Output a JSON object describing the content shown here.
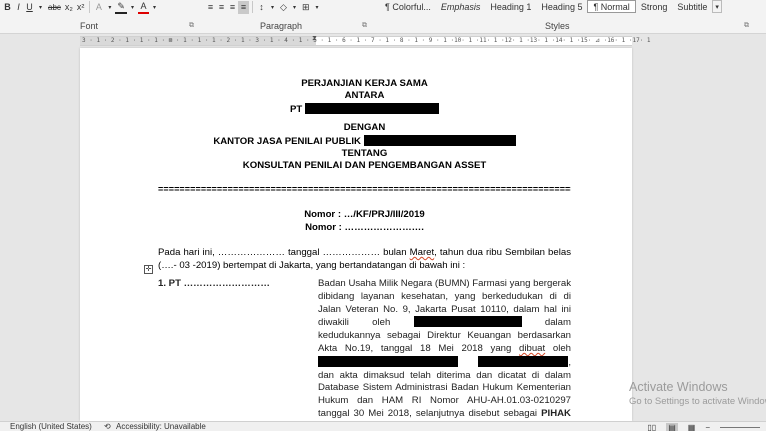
{
  "ribbon": {
    "font_buttons": [
      "B",
      "I",
      "U",
      "abc",
      "x₂",
      "x²"
    ],
    "paragraph_buttons": [
      "≡",
      "≡",
      "≡",
      "≡",
      "↕",
      "◇",
      "⊞"
    ],
    "styles": [
      "¶ Colorful...",
      "Emphasis",
      "Heading 1",
      "Heading 5",
      "¶ Normal",
      "Strong",
      "Subtitle"
    ],
    "selected_style": "¶ Normal",
    "groups": {
      "font": "Font",
      "paragraph": "Paragraph",
      "styles": "Styles"
    }
  },
  "ruler": {
    "ticks": "3 · 1 · 2 · 1 · 1 · 1 · ⊠ · 1 · 1 · 1 · 2 · 1 · 3 · 1 · 4 · 1 · 5 · 1 · 6 · 1 · 7 · 1 · 8 · 1 · 9 · 1 ·10· 1 ·11· 1 ·12· 1 ·13· 1 ·14· 1 ·15· ⊿ ·16· 1 ·17· 1"
  },
  "doc": {
    "title1": "PERJANJIAN KERJA SAMA",
    "title2": "ANTARA",
    "pt_prefix": "PT",
    "dengan": "DENGAN",
    "kantor_prefix": "KANTOR JASA PENILAI PUBLIK",
    "tentang": "TENTANG",
    "subject": "KONSULTAN PENILAI DAN PENGEMBANGAN ASSET",
    "separator": "==========================================================================================",
    "nomor1": "Nomor : …/KF/PRJ/III/2019",
    "nomor2": "Nomor : …………………….",
    "intro_a": "Pada hari ini, ………………… tanggal ……………… bulan ",
    "intro_maret": "Maret",
    "intro_b": ", tahun dua ribu Sembilan belas (….- 03 -2019) bertempat di Jakarta, yang bertandatangan di bawah ini :",
    "party_label": "1.  PT ………………………",
    "party_text_1": "Badan Usaha Milik Negara (BUMN) Farmasi yang bergerak dibidang layanan kesehatan, yang berkedudukan di di Jalan Veteran No. 9, Jakarta Pusat 10110, dalam hal ini diwakili oleh",
    "party_text_2": "dalam kedudukannya sebagai Direktur Keuangan berdasarkan Akta No.19, tanggal 18 Mei 2018 yang ",
    "party_dibuat": "dibuat",
    "party_text_3": " oleh",
    "party_text_4": ", dan akta dimaksud telah diterima dan dicatat di dalam Database Sistem Administrasi Badan Hukum Kementerian Hukum dan HAM RI Nomor AHU-AH.01.03-0210297 tanggal 30 Mei 2018, selanjutnya disebut sebagai ",
    "pihak": "PIHAK PERTAMA."
  },
  "status": {
    "language": "English (United States)",
    "accessibility": "Accessibility: Unavailable"
  },
  "watermark": {
    "line1": "Activate Windows",
    "line2": "Go to Settings to activate Windows."
  },
  "colors": {
    "ribbon_bg": "#f3f3f3",
    "page_bg": "#ffffff",
    "canvas_bg": "#e6e6e6"
  }
}
